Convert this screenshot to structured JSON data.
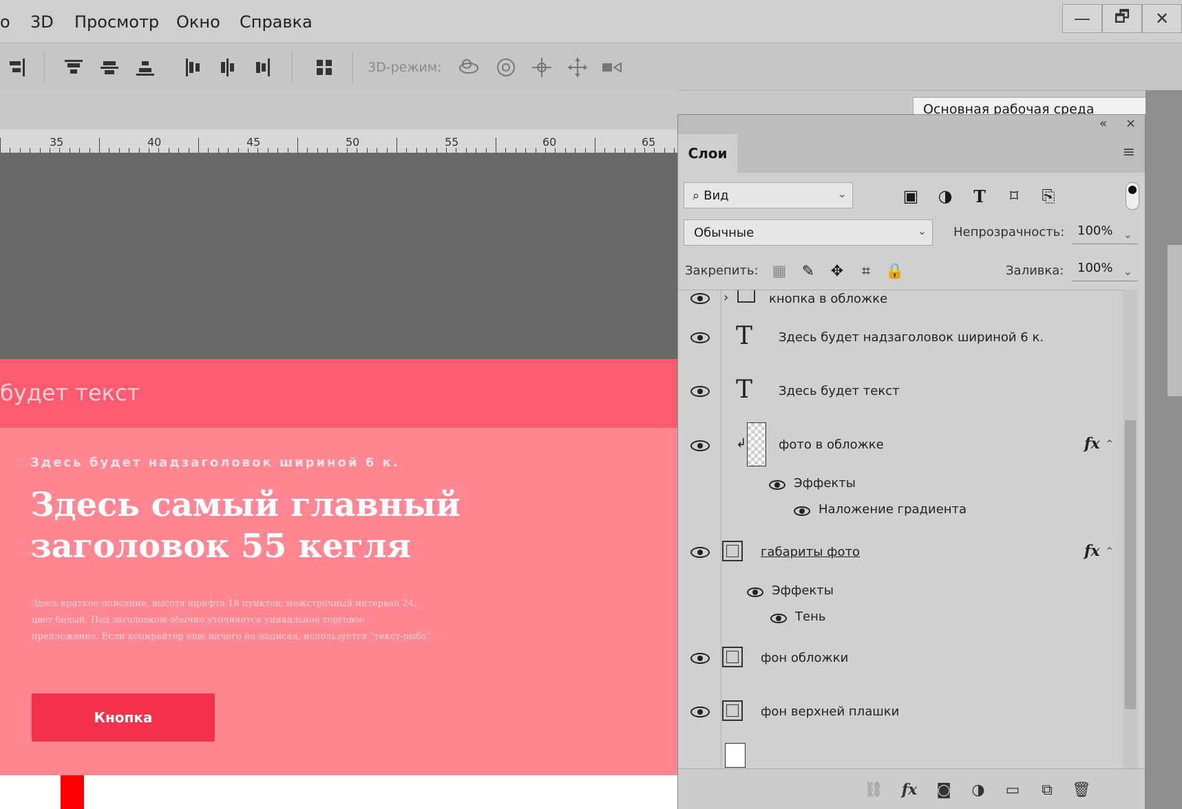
{
  "menu": [
    "о",
    "3D",
    "Просмотр",
    "Окно",
    "Справка"
  ],
  "window_controls": [
    "—",
    "🗗",
    "✕"
  ],
  "options_bar": {
    "mode3d_label": "3D-режим:",
    "workspace": "Основная рабочая среда"
  },
  "ruler": [
    "35",
    "40",
    "45",
    "50",
    "55",
    "60",
    "65"
  ],
  "canvas": {
    "strip_text": "будет текст",
    "eyebrow": "Здесь будет надзаголовок шириной 6 к.",
    "heading_line1": "Здесь самый главный",
    "heading_line2": "заголовок 55 кегля",
    "description": "Здесь краткое описание, высота шрифта 18 пунктов, межстрочный интервал 24, цвет белый. Под заголовком обычно уточняется уникальное торговое предложение. Если копирайтер еще ничего не написал, используется \"текст-рыба\"",
    "button": "Кнопка"
  },
  "panel": {
    "tab": "Слои",
    "filter": "Вид",
    "blend_mode": "Обычные",
    "opacity_label": "Непрозрачность:",
    "opacity": "100%",
    "lock_label": "Закрепить:",
    "fill_label": "Заливка:",
    "fill": "100%",
    "layers": [
      {
        "name": "кнопка в обложке",
        "kind": "group"
      },
      {
        "name": "Здесь будет надзаголовок шириной 6 к.",
        "kind": "text"
      },
      {
        "name": "Здесь будет текст",
        "kind": "text"
      },
      {
        "name": "фото в обложке",
        "kind": "image",
        "fx": "fx",
        "effects_label": "Эффекты",
        "effect": "Наложение градиента"
      },
      {
        "name": "габариты фото",
        "kind": "shape",
        "fx": "fx",
        "effects_label": "Эффекты",
        "effect": "Тень"
      },
      {
        "name": "фон обложки",
        "kind": "shape"
      },
      {
        "name": "фон верхней плашки",
        "kind": "shape"
      }
    ]
  },
  "colors": {
    "strip": "#fb5b6e",
    "hero": "#fe8793",
    "button": "#f4324c"
  }
}
